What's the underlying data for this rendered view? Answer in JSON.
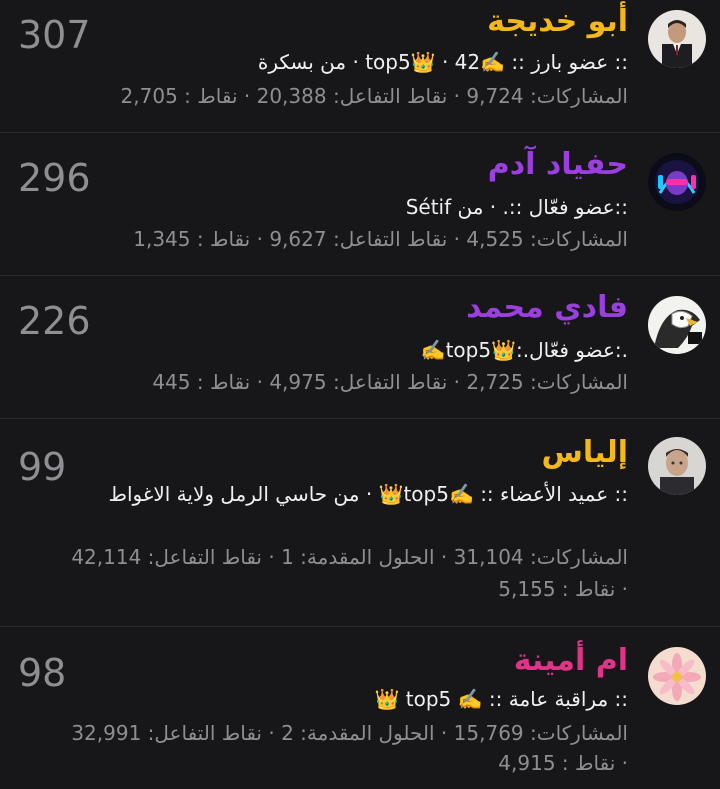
{
  "members": [
    {
      "name": "أبو خديجة",
      "name_color": "#f5b81b",
      "score": "307",
      "title_line": ":: عضو بارز :: ✍️top5👑 · 42 · من بسكرة",
      "stats_lines": [
        "المشاركات: 9,724 · نقاط التفاعل: 20,388 · نقاط : 2,705"
      ],
      "avatar": "man-in-suit-avatar"
    },
    {
      "name": "حفياد آدم",
      "name_color": "#9b3fe0",
      "score": "296",
      "title_line": "::عضو فعّال ::. · من Sétif",
      "stats_lines": [
        "المشاركات: 4,525 · نقاط التفاعل: 9,627 · نقاط : 1,345"
      ],
      "avatar": "neon-gamer-avatar"
    },
    {
      "name": "فادي محمد",
      "name_color": "#9b3fe0",
      "score": "226",
      "title_line": ".:عضو فعّال.:👑top5✍️",
      "stats_lines": [
        "المشاركات: 2,725 · نقاط التفاعل: 4,975 · نقاط : 445"
      ],
      "avatar": "eagle-avatar"
    },
    {
      "name": "إلياس",
      "name_color": "#f5b81b",
      "score": "99",
      "title_line": ":: عميد الأعضاء :: ✍️top5👑 · من حاسي الرمل ولاية الاغواط",
      "stats_lines": [
        "المشاركات: 31,104 · الحلول المقدمة: 1 · نقاط التفاعل: 42,114",
        "· نقاط : 5,155"
      ],
      "avatar": "man-portrait-avatar"
    },
    {
      "name": "ام أمينة",
      "name_color": "#e0338a",
      "score": "98",
      "title_line": ":: مراقبة عامة :: ✍️ top5 👑",
      "stats_lines": [
        "المشاركات: 15,769 · الحلول المقدمة: 2 · نقاط التفاعل: 32,991",
        "· نقاط : 4,915"
      ],
      "avatar": "pink-flower-avatar"
    }
  ]
}
